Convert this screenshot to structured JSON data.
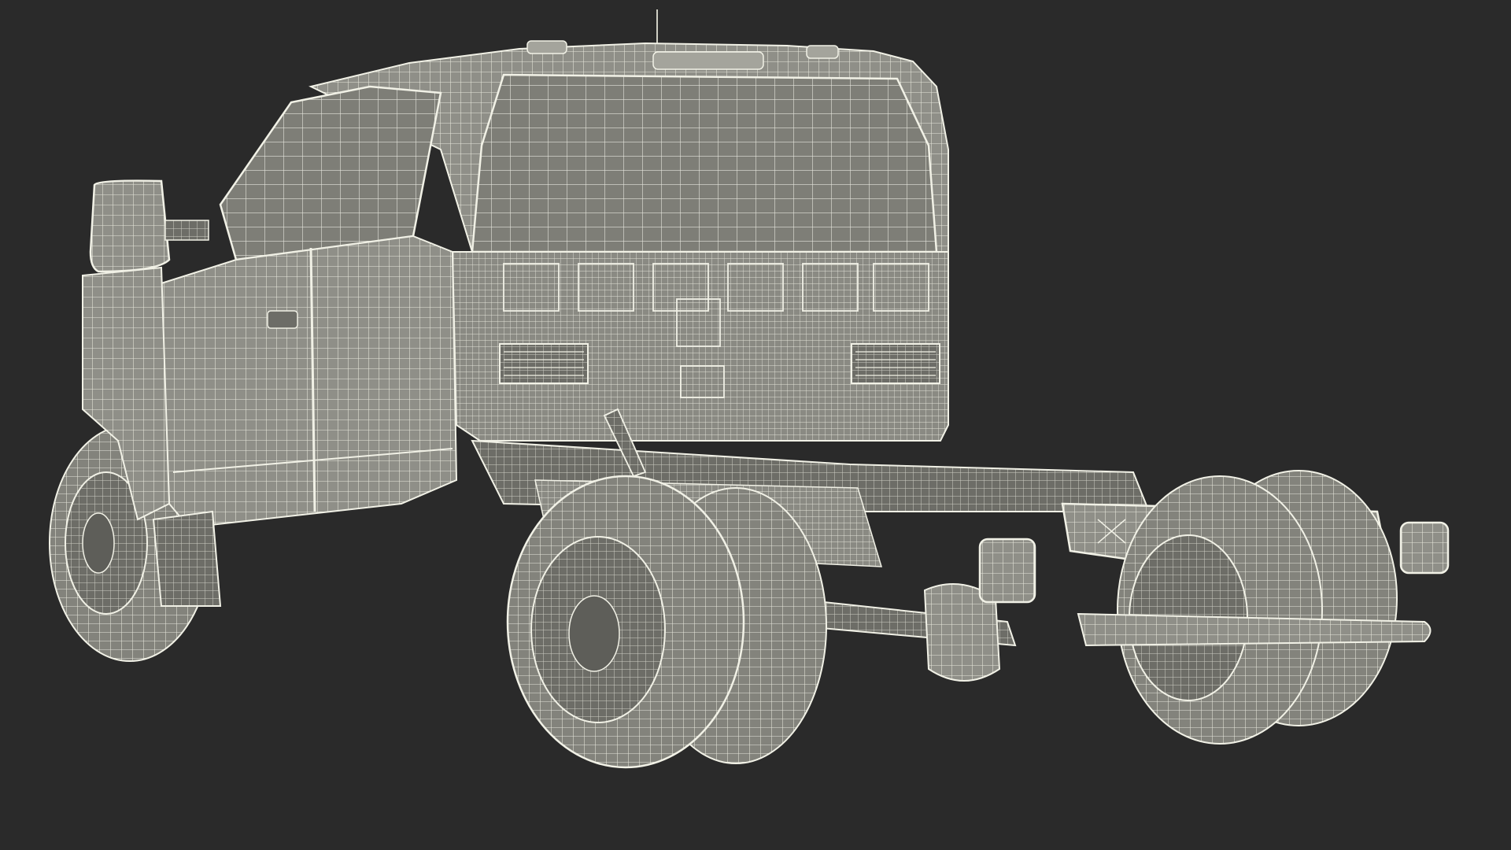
{
  "scene": {
    "background": "#2a2a2a",
    "model_fill": "#8f8f88",
    "model_fill_dark": "#6d6d67",
    "model_fill_light": "#a4a49c",
    "wire_color": "#f1f1e6",
    "detail_color": "#3a3a36",
    "subject": "truck-chassis-wireframe"
  }
}
